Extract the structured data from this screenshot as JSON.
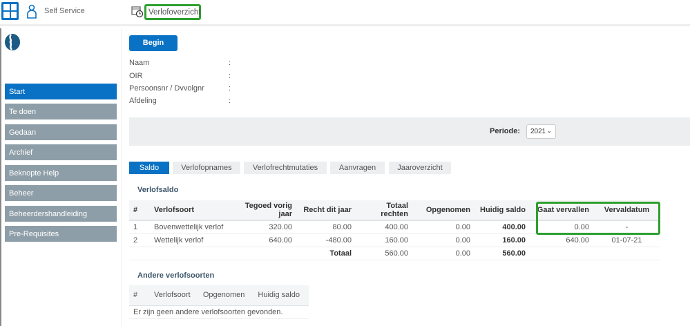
{
  "header": {
    "app_label": "Self Service",
    "page_title": "Verlofoverzicht"
  },
  "sidebar": {
    "items": [
      {
        "label": "Start"
      },
      {
        "label": "Te doen"
      },
      {
        "label": "Gedaan"
      },
      {
        "label": "Archief"
      },
      {
        "label": "Beknopte Help"
      },
      {
        "label": "Beheer"
      },
      {
        "label": "Beheerdershandleiding"
      },
      {
        "label": "Pre-Requisites"
      }
    ]
  },
  "main": {
    "begin_label": "Begin",
    "info": [
      {
        "label": "Naam",
        "sep": ":"
      },
      {
        "label": "OIR",
        "sep": ":"
      },
      {
        "label": "Persoonsnr / Dvvolgnr",
        "sep": ":"
      },
      {
        "label": "Afdeling",
        "sep": ":"
      }
    ],
    "periode_label": "Periode:",
    "periode_value": "2021",
    "tabs": [
      {
        "label": "Saldo"
      },
      {
        "label": "Verlofopnames"
      },
      {
        "label": "Verlofrechtmutaties"
      },
      {
        "label": "Aanvragen"
      },
      {
        "label": "Jaaroverzicht"
      }
    ],
    "saldo": {
      "title": "Verlofsaldo",
      "headers": [
        "#",
        "Verlofsoort",
        "Tegoed vorig jaar",
        "Recht dit jaar",
        "Totaal rechten",
        "Opgenomen",
        "Huidig saldo",
        "Gaat vervallen",
        "Vervaldatum"
      ],
      "rows": [
        [
          "1",
          "Bovenwettelijk verlof",
          "320.00",
          "80.00",
          "400.00",
          "0.00",
          "400.00",
          "0.00",
          "-"
        ],
        [
          "2",
          "Wettelijk verlof",
          "640.00",
          "-480.00",
          "160.00",
          "0.00",
          "160.00",
          "640.00",
          "01-07-21"
        ]
      ],
      "total": {
        "label": "Totaal",
        "totaal_rechten": "560.00",
        "opgenomen": "0.00",
        "huidig_saldo": "560.00"
      }
    },
    "andere": {
      "title": "Andere verlofsoorten",
      "headers": [
        "#",
        "Verlofsoort",
        "Opgenomen",
        "Huidig saldo"
      ],
      "empty": "Er zijn geen andere verlofsoorten gevonden."
    }
  },
  "colors": {
    "accent": "#0a72c4",
    "highlight": "#2ea02e",
    "nav": "#8e9ea8"
  }
}
